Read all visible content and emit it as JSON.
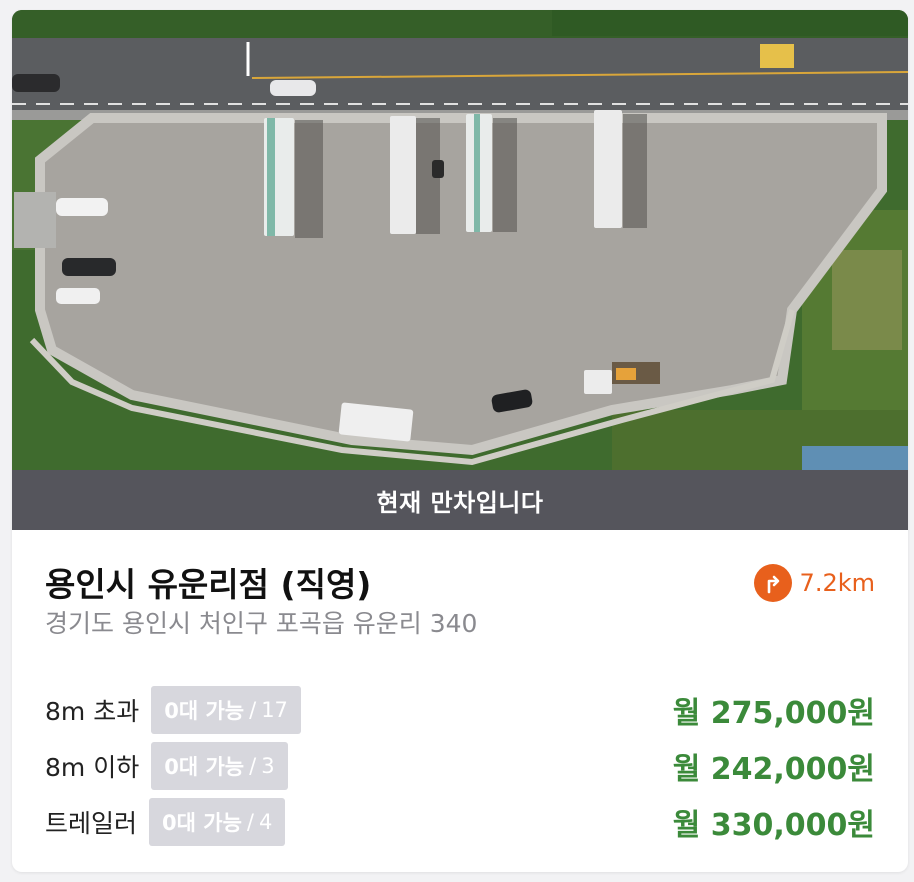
{
  "banner": {
    "status_text": "현재 만차입니다"
  },
  "lot": {
    "name": "용인시 유운리점 (직영)",
    "address": "경기도 용인시 처인구 포곡읍 유운리 340",
    "distance": "7.2km"
  },
  "rates": [
    {
      "label": "8m 초과",
      "available": "0대 가능",
      "capacity": "17",
      "price": "월 275,000원"
    },
    {
      "label": "8m 이하",
      "available": "0대 가능",
      "capacity": "3",
      "price": "월 242,000원"
    },
    {
      "label": "트레일러",
      "available": "0대 가능",
      "capacity": "4",
      "price": "월 330,000원"
    }
  ],
  "colors": {
    "accent_orange": "#e8601c",
    "price_green": "#3b8a3a",
    "banner_gray": "#55555c",
    "badge_gray": "#d7d7dd"
  },
  "icons": {
    "distance": "route-turn-icon"
  }
}
